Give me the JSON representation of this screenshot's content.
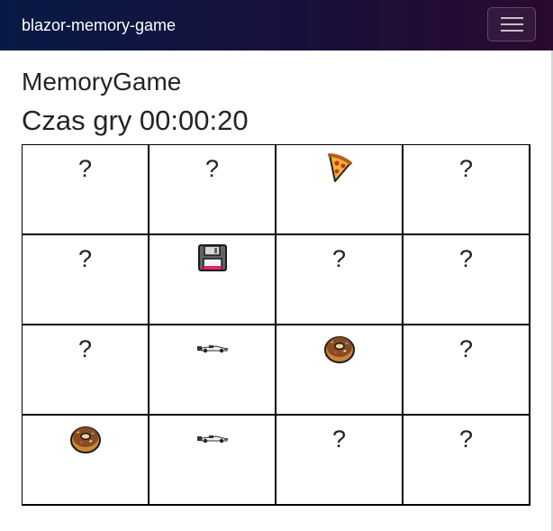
{
  "navbar": {
    "brand": "blazor-memory-game",
    "toggler_icon": "hamburger-menu-icon"
  },
  "page": {
    "title": "MemoryGame",
    "time_label": "Czas gry 00:00:20"
  },
  "board": {
    "hidden_symbol": "?",
    "cards": [
      {
        "state": "hidden"
      },
      {
        "state": "hidden"
      },
      {
        "state": "revealed",
        "icon": "pizza"
      },
      {
        "state": "hidden"
      },
      {
        "state": "hidden"
      },
      {
        "state": "revealed",
        "icon": "floppy-disk"
      },
      {
        "state": "hidden"
      },
      {
        "state": "hidden"
      },
      {
        "state": "hidden"
      },
      {
        "state": "revealed",
        "icon": "racing-car"
      },
      {
        "state": "revealed",
        "icon": "doughnut"
      },
      {
        "state": "hidden"
      },
      {
        "state": "revealed",
        "icon": "doughnut"
      },
      {
        "state": "revealed",
        "icon": "racing-car"
      },
      {
        "state": "hidden"
      },
      {
        "state": "hidden"
      }
    ]
  }
}
